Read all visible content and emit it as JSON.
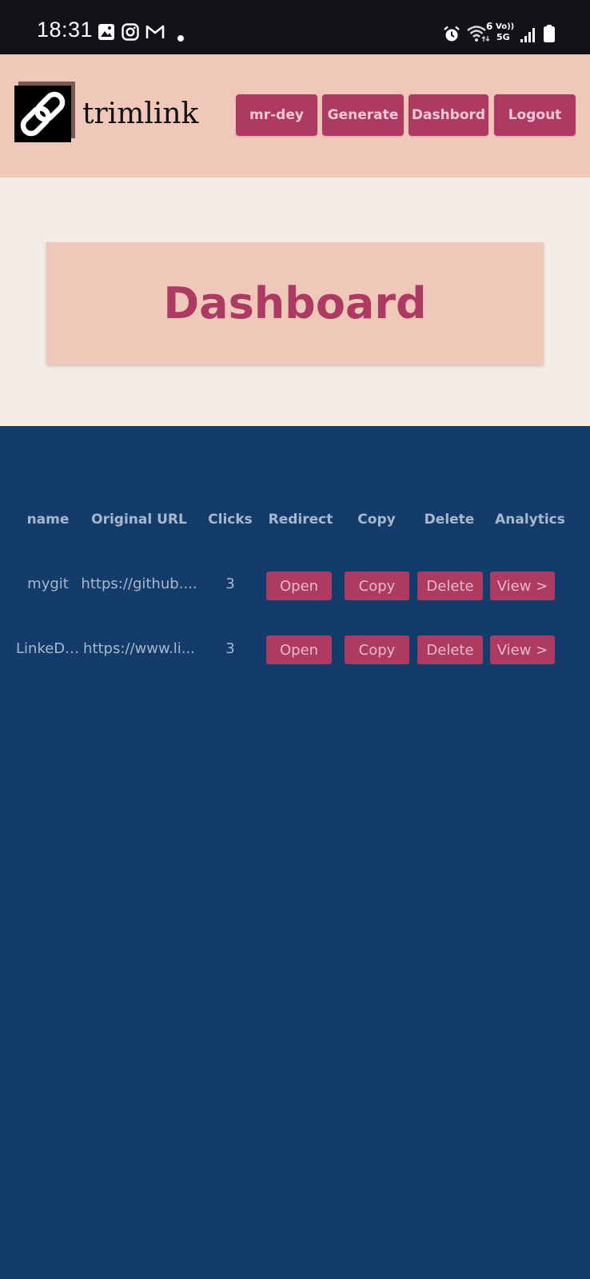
{
  "status_bar": {
    "time": "18:31",
    "left_icons": [
      "gallery-icon",
      "instagram-icon",
      "gmail-icon",
      "dot-icon"
    ],
    "right_icons": [
      "alarm-icon",
      "wifi-icon",
      "volte-5g-icon",
      "signal-icon",
      "battery-icon"
    ],
    "wifi_label": "6",
    "volte_label": "Vo))",
    "network_label": "5G"
  },
  "header": {
    "brand": "trimlink",
    "nav": {
      "user": "mr-dey",
      "generate": "Generate",
      "dashboard": "Dashbord",
      "logout": "Logout"
    }
  },
  "page_title": "Dashboard",
  "table": {
    "headers": {
      "name": "name",
      "url": "Original URL",
      "clicks": "Clicks",
      "redirect": "Redirect",
      "copy": "Copy",
      "delete": "Delete",
      "analytics": "Analytics"
    },
    "rows": [
      {
        "name": "mygit",
        "url": "https://github....",
        "clicks": "3",
        "open": "Open",
        "copy": "Copy",
        "delete": "Delete",
        "view": "View >"
      },
      {
        "name": "LinkeDi...",
        "url": "https://www.li...",
        "clicks": "3",
        "open": "Open",
        "copy": "Copy",
        "delete": "Delete",
        "view": "View >"
      }
    ]
  },
  "colors": {
    "accent": "#AC3A62",
    "header_bg": "#EFC8B9",
    "page_bg": "#133C6B",
    "title_band_bg": "#F5ECE6"
  }
}
